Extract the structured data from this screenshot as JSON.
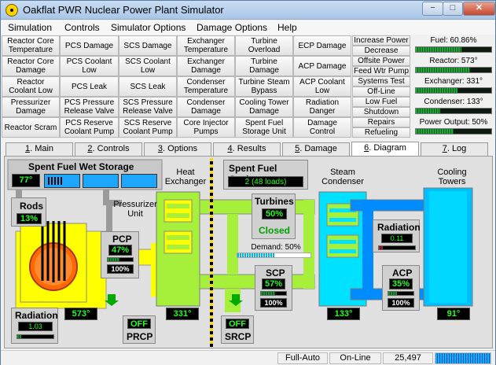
{
  "window": {
    "title": "Oakflat PWR Nuclear Power Plant Simulator",
    "minimize": "−",
    "maximize": "□",
    "close": "✕"
  },
  "menu": [
    "Simulation",
    "Controls",
    "Simulator Options",
    "Damage Options",
    "Help"
  ],
  "control_buttons": [
    [
      "Reactor Core Temperature",
      "PCS Damage",
      "SCS Damage",
      "Exchanger Temperature",
      "Turbine Overload",
      "ECP Damage"
    ],
    [
      "Reactor Core Damage",
      "PCS Coolant Low",
      "SCS Coolant Low",
      "Exchanger Damage",
      "Turbine Damage",
      "ACP Damage"
    ],
    [
      "Reactor Coolant Low",
      "PCS Leak",
      "SCS Leak",
      "Condenser Temperature",
      "Turbine Steam Bypass",
      "ACP Coolant Low"
    ],
    [
      "Pressurizer Damage",
      "PCS Pressure Release Valve",
      "SCS Pressure Release Valve",
      "Condenser Damage",
      "Cooling Tower Damage",
      "Radiation Danger"
    ],
    [
      "Reactor Scram",
      "PCS Reserve Coolant Pump",
      "SCS Reserve Coolant Pump",
      "Core Injector Pumps",
      "Spent Fuel Storage Unit",
      "Damage Control"
    ]
  ],
  "right_buttons": [
    "Increase Power",
    "Decrease Power",
    "Offsite Power",
    "Feed Wtr Pump",
    "Systems Test",
    "Off-Line",
    "Low Fuel",
    "Shutdown Mode",
    "Repairs",
    "Refueling"
  ],
  "gauges": [
    {
      "label": "Fuel: 60.86%",
      "level": 0.6086
    },
    {
      "label": "Reactor: 573°",
      "level": 0.72
    },
    {
      "label": "Exchanger: 331°",
      "level": 0.55
    },
    {
      "label": "Condenser: 133°",
      "level": 0.32
    },
    {
      "label": "Power Output: 50%",
      "level": 0.5
    }
  ],
  "tabs": [
    {
      "num": "1",
      "label": "Main"
    },
    {
      "num": "2",
      "label": "Controls"
    },
    {
      "num": "3",
      "label": "Options"
    },
    {
      "num": "4",
      "label": "Results"
    },
    {
      "num": "5",
      "label": "Damage"
    },
    {
      "num": "6",
      "label": "Diagram"
    },
    {
      "num": "7",
      "label": "Log"
    }
  ],
  "active_tab_index": 5,
  "diagram": {
    "spent_fuel_wet_storage": {
      "title": "Spent Fuel Wet Storage",
      "temp": "77°"
    },
    "spent_fuel_casks": {
      "title": "Spent Fuel Casks",
      "value": "2",
      "loads": "(48 loads)"
    },
    "rods": {
      "title": "Rods",
      "value": "13%"
    },
    "pressurizer_label": "Pressurizer Unit",
    "heat_exchanger_label": "Heat Exchanger",
    "steam_condenser_label": "Steam Condenser",
    "cooling_towers_label": "Cooling Towers",
    "pcp": {
      "title": "PCP",
      "value": "47%",
      "flow": "100%",
      "level": 0.47
    },
    "turbines": {
      "title": "Turbines",
      "value": "50%",
      "state": "Closed"
    },
    "demand": {
      "label": "Demand: 50%",
      "level": 0.5
    },
    "radiation_right": {
      "title": "Radiation",
      "value": "0.11",
      "level": 0.11
    },
    "scp": {
      "title": "SCP",
      "value": "57%",
      "flow": "100%",
      "level": 0.57
    },
    "acp": {
      "title": "ACP",
      "value": "35%",
      "flow": "100%",
      "level": 0.35
    },
    "radiation_left": {
      "title": "Radiation",
      "value": "1.03",
      "level": 0.1
    },
    "temps": {
      "reactor": "573°",
      "exchanger": "331°",
      "condenser": "133°",
      "tower": "91°"
    },
    "prcp": {
      "state": "OFF",
      "label": "PRCP"
    },
    "srcp": {
      "state": "OFF",
      "label": "SRCP"
    }
  },
  "status": {
    "mode": "Full-Auto",
    "online": "On-Line",
    "count": "25,497"
  }
}
